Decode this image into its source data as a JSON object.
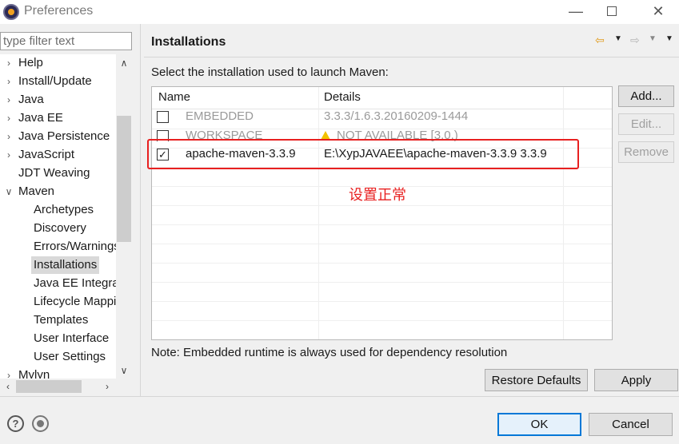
{
  "window": {
    "title": "Preferences",
    "icon": "eclipse-icon"
  },
  "filter": {
    "placeholder": "type filter text"
  },
  "tree": {
    "items": [
      {
        "label": "Help",
        "expandable": true
      },
      {
        "label": "Install/Update",
        "expandable": true
      },
      {
        "label": "Java",
        "expandable": true
      },
      {
        "label": "Java EE",
        "expandable": true
      },
      {
        "label": "Java Persistence",
        "expandable": true
      },
      {
        "label": "JavaScript",
        "expandable": true
      },
      {
        "label": "JDT Weaving",
        "expandable": false
      },
      {
        "label": "Maven",
        "expanded": true
      },
      {
        "label": "Archetypes"
      },
      {
        "label": "Discovery"
      },
      {
        "label": "Errors/Warnings"
      },
      {
        "label": "Installations",
        "selected": true
      },
      {
        "label": "Java EE Integration"
      },
      {
        "label": "Lifecycle Mappings"
      },
      {
        "label": "Templates"
      },
      {
        "label": "User Interface"
      },
      {
        "label": "User Settings"
      },
      {
        "label": "Mylyn",
        "expandable": true
      }
    ]
  },
  "page": {
    "title": "Installations",
    "instruction": "Select the installation used to launch Maven:",
    "note": "Note: Embedded runtime is always used for dependency resolution"
  },
  "table": {
    "columns": [
      "Name",
      "Details"
    ],
    "rows": [
      {
        "checked": false,
        "name": "EMBEDDED",
        "details": "3.3.3/1.6.3.20160209-1444",
        "disabled": true
      },
      {
        "checked": false,
        "name": "WORKSPACE",
        "details": "NOT AVAILABLE [3.0,)",
        "disabled": true,
        "warning": true
      },
      {
        "checked": true,
        "name": "apache-maven-3.3.9",
        "details": "E:\\XypJAVAEE\\apache-maven-3.3.9 3.3.9",
        "disabled": false
      }
    ]
  },
  "annotation": {
    "text": "设置正常",
    "color": "#e82020"
  },
  "buttons": {
    "add": "Add...",
    "edit": "Edit...",
    "remove": "Remove",
    "restore": "Restore Defaults",
    "apply": "Apply",
    "ok": "OK",
    "cancel": "Cancel"
  },
  "colors": {
    "accent": "#0078d7",
    "highlight": "#e82020",
    "warning": "#f2c200"
  }
}
